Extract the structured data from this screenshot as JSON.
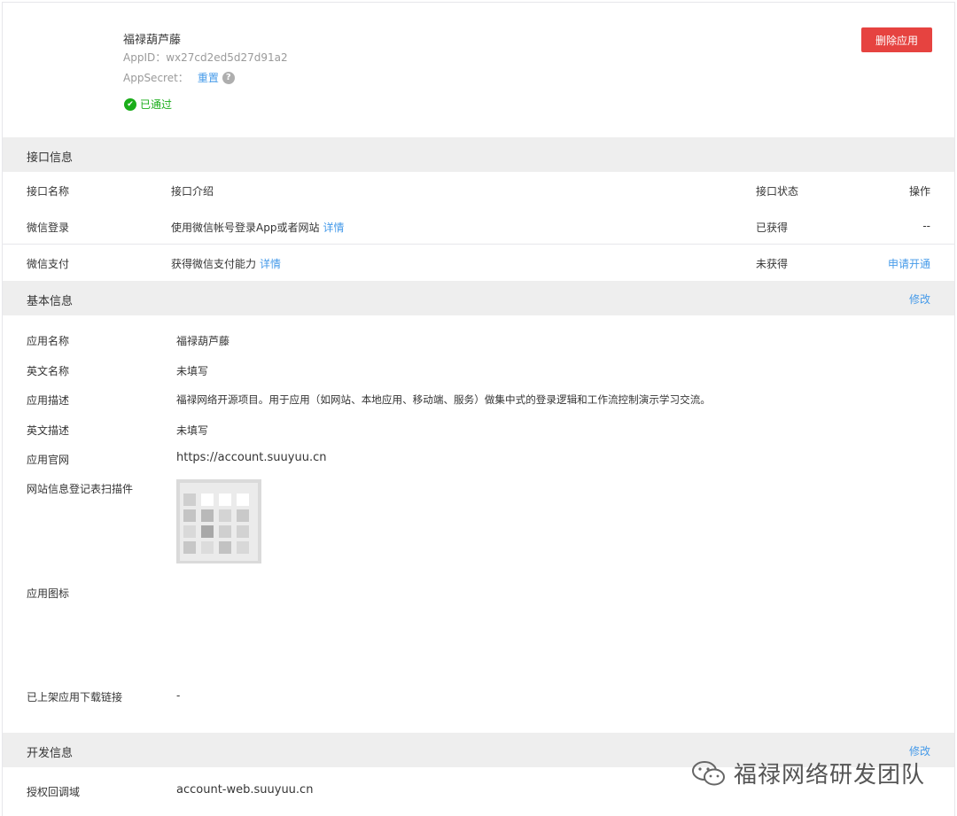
{
  "app": {
    "name": "福禄葫芦藤",
    "appid": "AppID：wx27cd2ed5d27d91a2",
    "secret_label": "AppSecret：",
    "secret_reset": "重置",
    "help": "?",
    "status": "已通过",
    "delete_button": "删除应用"
  },
  "interface_section": {
    "title": "接口信息",
    "headers": {
      "name": "接口名称",
      "intro": "接口介绍",
      "status": "接口状态",
      "op": "操作"
    },
    "rows": [
      {
        "name": "微信登录",
        "intro": "使用微信帐号登录App或者网站",
        "detail": "详情",
        "status": "已获得",
        "op": "--"
      },
      {
        "name": "微信支付",
        "intro": "获得微信支付能力",
        "detail": "详情",
        "status": "未获得",
        "op": "申请开通"
      }
    ]
  },
  "basic_section": {
    "title": "基本信息",
    "edit": "修改",
    "fields": {
      "app_name": {
        "label": "应用名称",
        "value": "福禄葫芦藤"
      },
      "en_name": {
        "label": "英文名称",
        "value": "未填写"
      },
      "desc": {
        "label": "应用描述",
        "value": "福禄网络开源项目。用于应用（如网站、本地应用、移动端、服务）做集中式的登录逻辑和工作流控制演示学习交流。"
      },
      "en_desc": {
        "label": "英文描述",
        "value": "未填写"
      },
      "website": {
        "label": "应用官网",
        "value": "https://account.suuyuu.cn"
      },
      "scan": {
        "label": "网站信息登记表扫描件"
      },
      "icon": {
        "label": "应用图标"
      },
      "download": {
        "label": "已上架应用下载链接",
        "value": "-"
      }
    }
  },
  "dev_section": {
    "title": "开发信息",
    "edit": "修改",
    "callback": {
      "label": "授权回调域",
      "value": "account-web.suuyuu.cn"
    }
  },
  "watermark": {
    "text": "福禄网络研发团队"
  },
  "colors": {
    "link": "#459ae9",
    "danger": "#e64340",
    "success": "#1aad19",
    "bar": "#eeeeee"
  }
}
